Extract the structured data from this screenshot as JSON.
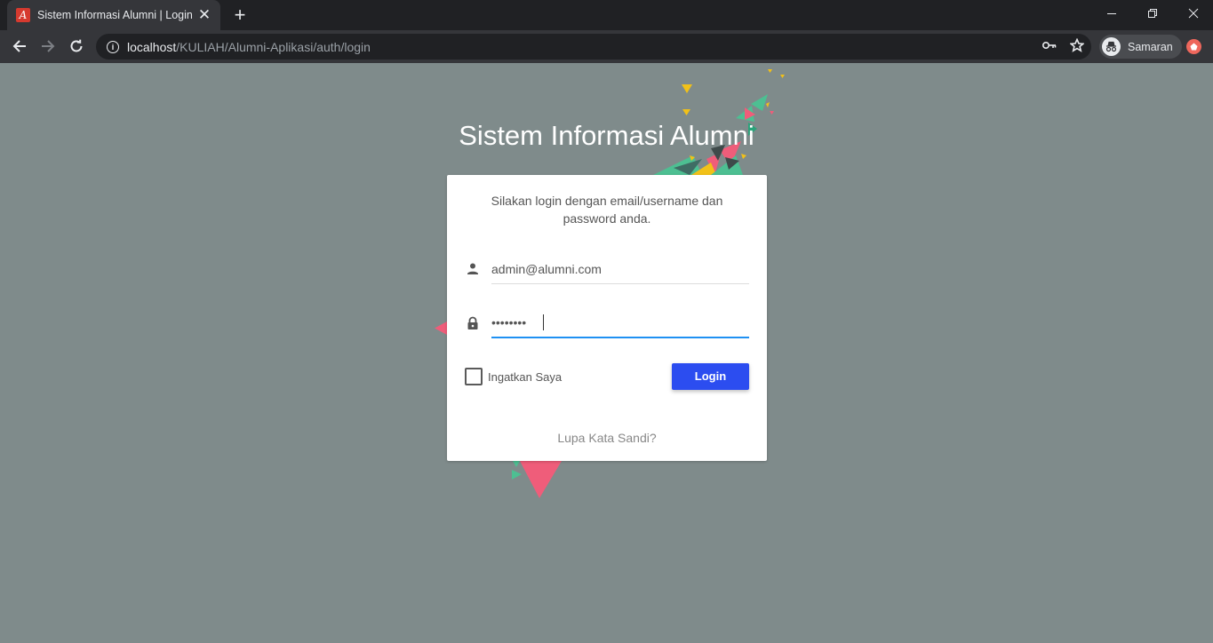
{
  "browser": {
    "tab": {
      "title": "Sistem Informasi Alumni | Login",
      "favicon_letter": "A",
      "close_glyph": "✕"
    },
    "new_tab_glyph": "+",
    "address": {
      "host": "localhost",
      "path": "/KULIAH/Alumni-Aplikasi/auth/login"
    },
    "profile_label": "Samaran",
    "icons": [
      "back-icon",
      "forward-icon",
      "reload-icon",
      "info-icon",
      "key-icon",
      "star-icon",
      "incognito-icon",
      "minimize-icon",
      "restore-icon",
      "close-window-icon"
    ]
  },
  "page": {
    "title": "Sistem Informasi Alumni",
    "message": "Silakan login dengan email/username dan password anda.",
    "username": {
      "value": "admin@alumni.com",
      "icon": "person-icon"
    },
    "password": {
      "value": "••••••••",
      "icon": "lock-icon"
    },
    "remember_label": "Ingatkan Saya",
    "login_label": "Login",
    "forgot_label": "Lupa Kata Sandi?"
  },
  "colors": {
    "page_bg": "#7f8b8b",
    "button": "#2c4df0",
    "focus_underline": "#1f91f3",
    "deco_pink": "#ef5d7a",
    "deco_green": "#4dbf92",
    "deco_yellow": "#f2c118"
  }
}
